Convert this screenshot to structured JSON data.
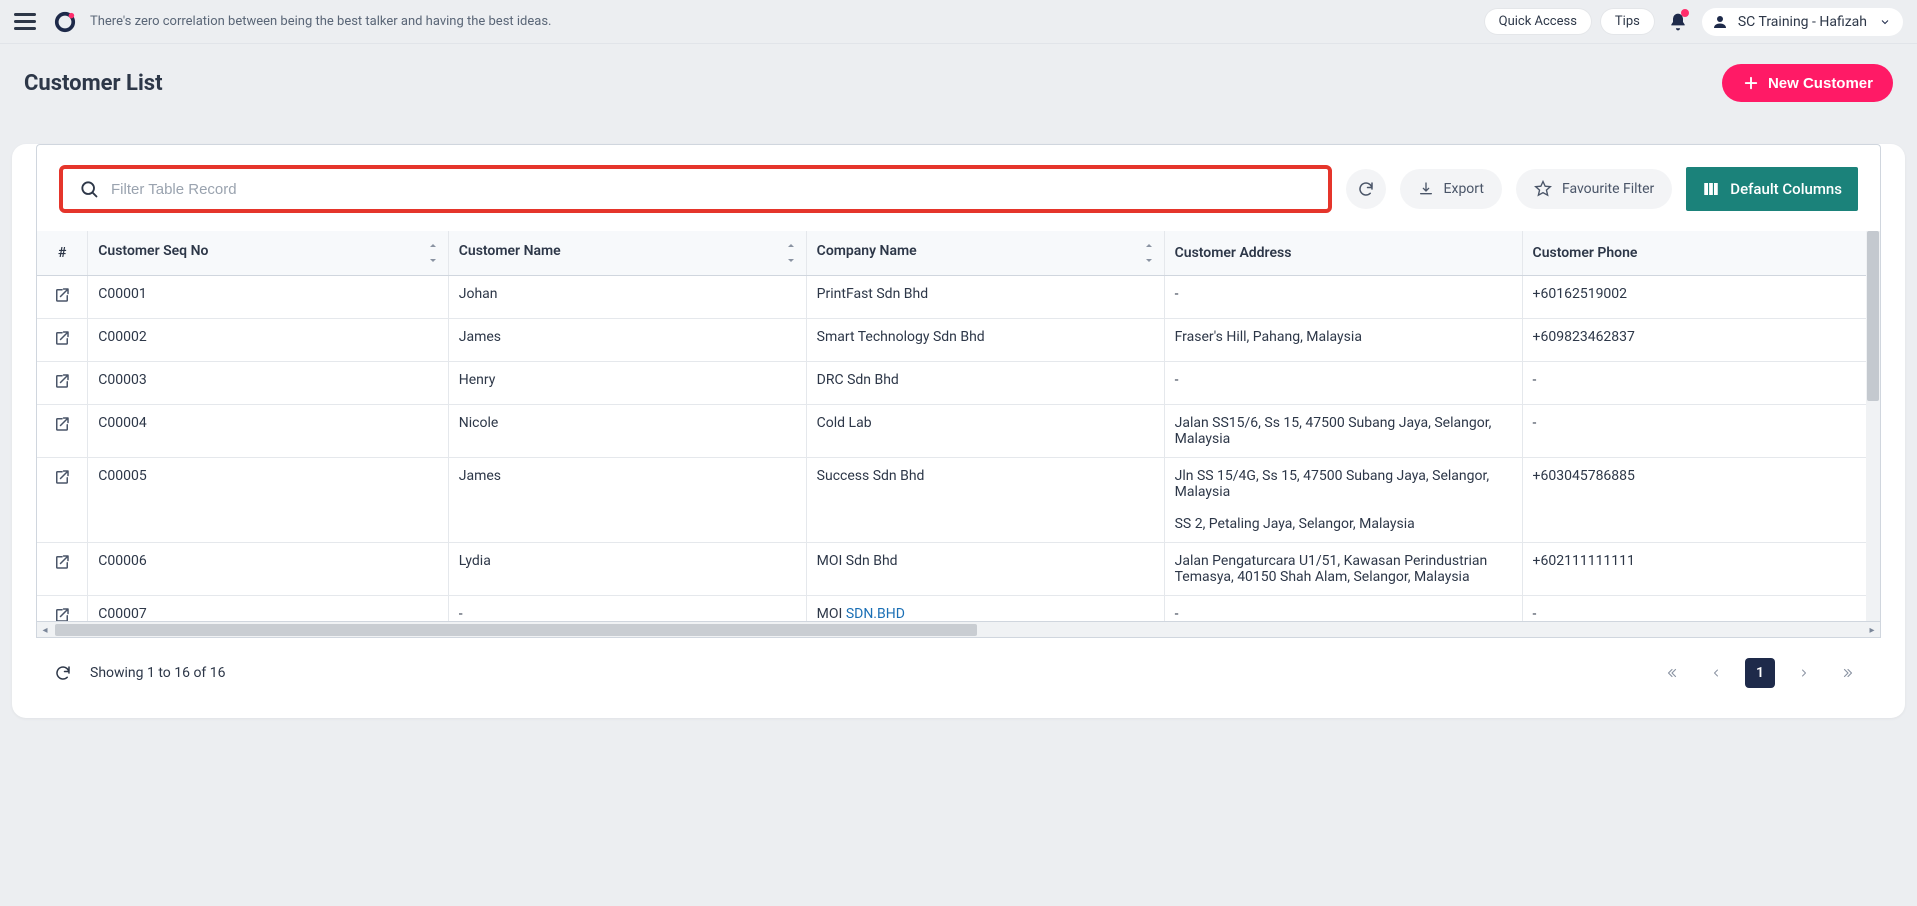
{
  "header": {
    "tagline": "There's zero correlation between being the best talker and having the best ideas.",
    "quick_access": "Quick Access",
    "tips": "Tips",
    "user_label": "SC Training - Hafizah"
  },
  "page": {
    "title": "Customer List",
    "new_button": "New Customer"
  },
  "toolbar": {
    "search_placeholder": "Filter Table Record",
    "export": "Export",
    "favourite": "Favourite Filter",
    "default_columns": "Default Columns"
  },
  "columns": {
    "action": "#",
    "seq": "Customer Seq No",
    "name": "Customer Name",
    "company": "Company Name",
    "address": "Customer Address",
    "phone": "Customer Phone"
  },
  "rows": [
    {
      "seq": "C00001",
      "name": "Johan",
      "company": "PrintFast Sdn Bhd",
      "address": "-",
      "phone": "+60162519002"
    },
    {
      "seq": "C00002",
      "name": "James",
      "company": "Smart Technology Sdn Bhd",
      "address": "Fraser's Hill, Pahang, Malaysia",
      "phone": "+609823462837"
    },
    {
      "seq": "C00003",
      "name": "Henry",
      "company": "DRC Sdn Bhd",
      "address": "-",
      "phone": "-"
    },
    {
      "seq": "C00004",
      "name": "Nicole",
      "company": "Cold Lab",
      "address": "Jalan SS15/6, Ss 15, 47500 Subang Jaya, Selangor, Malaysia",
      "phone": "-"
    },
    {
      "seq": "C00005",
      "name": "James",
      "company": "Success Sdn Bhd",
      "address": "Jln SS 15/4G, Ss 15, 47500 Subang Jaya, Selangor, Malaysia\n\nSS 2, Petaling Jaya, Selangor, Malaysia",
      "phone": "+603045786885"
    },
    {
      "seq": "C00006",
      "name": "Lydia",
      "company": "MOI Sdn Bhd",
      "address": "Jalan Pengaturcara U1/51, Kawasan Perindustrian Temasya, 40150 Shah Alam, Selangor, Malaysia",
      "phone": "+602111111111"
    },
    {
      "seq": "C00007",
      "name": "-",
      "company_prefix": "MOI ",
      "company_link": "SDN.BHD",
      "address": "-",
      "phone": "-"
    }
  ],
  "pager": {
    "info": "Showing 1 to 16 of 16",
    "current": "1"
  }
}
